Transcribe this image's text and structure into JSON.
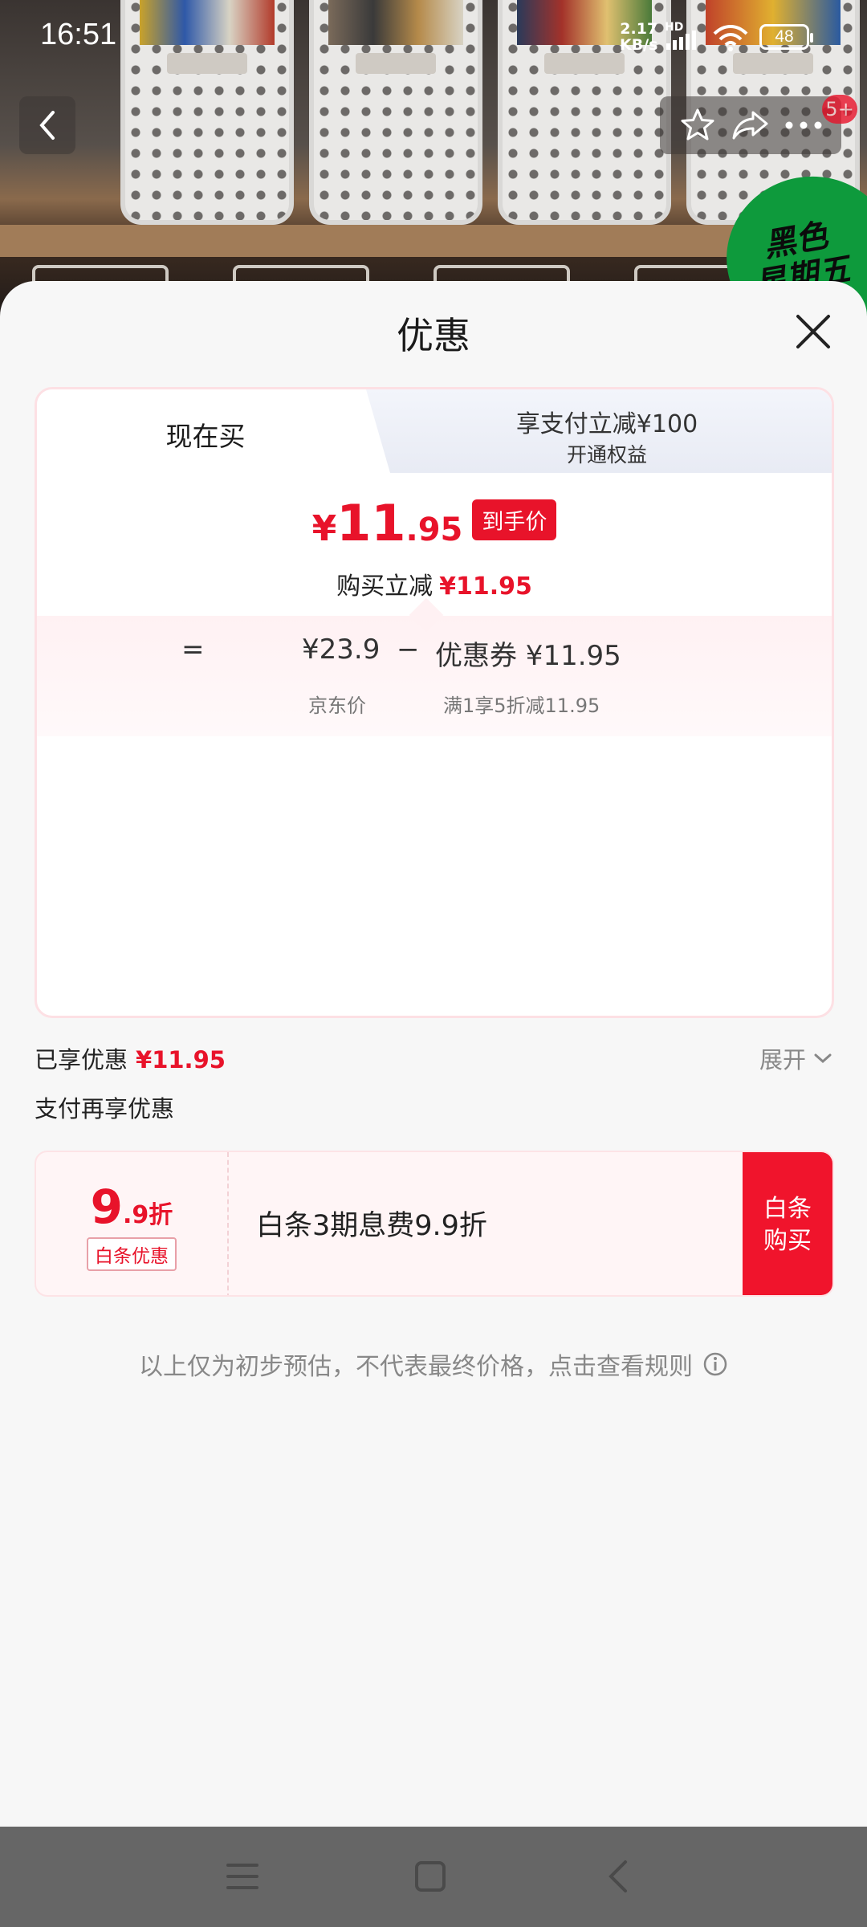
{
  "status_bar": {
    "time": "16:51",
    "net_speed_value": "2.17",
    "net_speed_unit": "KB/s",
    "hd_label": "HD",
    "battery": "48"
  },
  "header": {
    "cart_badge": "5+",
    "promo_stamp_line1": "黑色",
    "promo_stamp_line2": "星期五"
  },
  "sheet": {
    "title": "优惠"
  },
  "tabs": [
    {
      "label": "现在买",
      "selected": true
    },
    {
      "label": "享支付立减¥100",
      "sublabel": "开通权益",
      "selected": false
    }
  ],
  "price": {
    "symbol": "¥",
    "integer": "11",
    "decimal": ".95",
    "tag": "到手价",
    "reduce_label": "购买立减",
    "reduce_value": "¥11.95"
  },
  "breakdown": {
    "equals": "=",
    "jd_price": "¥23.9",
    "jd_price_label": "京东价",
    "minus": "−",
    "coupon": "优惠券 ¥11.95",
    "coupon_label": "满1享5折减11.95"
  },
  "enjoyed": {
    "label": "已享优惠",
    "value": "¥11.95",
    "expand_label": "展开"
  },
  "pay_more": {
    "label": "支付再享优惠"
  },
  "coupon_card": {
    "discount_big": "9",
    "discount_small": ".9折",
    "tag": "白条优惠",
    "description": "白条3期息费9.9折",
    "button_line1": "白条",
    "button_line2": "购买"
  },
  "disclaimer": "以上仅为初步预估，不代表最终价格，点击查看规则",
  "colors": {
    "accent": "#e8132a",
    "card_border": "#fde0e4",
    "navbar": "#666666"
  }
}
